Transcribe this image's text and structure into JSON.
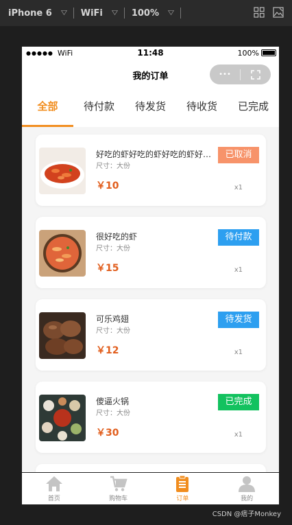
{
  "devtools": {
    "device": "iPhone 6",
    "network": "WiFi",
    "zoom": "100%"
  },
  "statusbar": {
    "signal": "●●●●●",
    "wifi": "WiFi",
    "time": "11:48",
    "battery": "100%"
  },
  "navbar": {
    "title": "我的订单",
    "more_glyph": "•••"
  },
  "tabs": [
    "全部",
    "待付款",
    "待发货",
    "待收货",
    "已完成"
  ],
  "active_tab": 0,
  "orders": [
    {
      "title": "好吃的虾好吃的虾好吃的虾好吃的虾",
      "spec": "尺寸：大份",
      "price": "￥10",
      "qty": "x1",
      "status": "已取消",
      "status_color": "#f7936a",
      "image": "shrimp-dish-1"
    },
    {
      "title": "很好吃的虾",
      "spec": "尺寸：大份",
      "price": "￥15",
      "qty": "x1",
      "status": "待付款",
      "status_color": "#2d9ff0",
      "image": "shrimp-dish-2"
    },
    {
      "title": "可乐鸡翅",
      "spec": "尺寸：大份",
      "price": "￥12",
      "qty": "x1",
      "status": "待发货",
      "status_color": "#2d9ff0",
      "image": "cola-chicken-wings"
    },
    {
      "title": "傻逼火锅",
      "spec": "尺寸：大份",
      "price": "￥30",
      "qty": "x1",
      "status": "已完成",
      "status_color": "#13c25f",
      "image": "hotpot"
    }
  ],
  "tabbar": [
    {
      "label": "首页",
      "icon": "home-icon"
    },
    {
      "label": "购物车",
      "icon": "cart-icon"
    },
    {
      "label": "订单",
      "icon": "order-icon"
    },
    {
      "label": "我的",
      "icon": "user-icon"
    }
  ],
  "active_tabbar": 2,
  "colors": {
    "accent": "#f18d1e",
    "price": "#e15e1d",
    "inactive_icon": "#c4c4c4"
  },
  "watermark": "CSDN @痞子Monkey"
}
